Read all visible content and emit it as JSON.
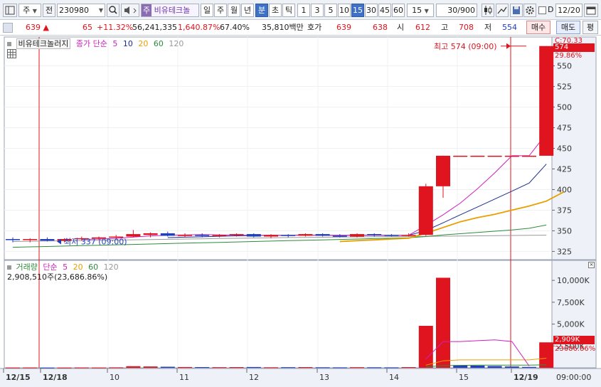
{
  "toolbar": {
    "period_type": "주",
    "prev_label": "전",
    "stock_code": "230980",
    "stock_badge": "주",
    "stock_name": "비유테크놀",
    "periods": [
      "일",
      "주",
      "월",
      "년",
      "분",
      "초",
      "틱"
    ],
    "selected_period": "분",
    "intervals": [
      "1",
      "3",
      "5",
      "10",
      "15",
      "30",
      "45",
      "60"
    ],
    "selected_interval": "15",
    "interval_value": "15",
    "count_value": "30",
    "count_total": "/900",
    "checkbox_label": "D",
    "date_value": "12/20"
  },
  "quote": {
    "price": "639",
    "up_arrow": "▲",
    "change": "65",
    "change_pct": "+11.32%",
    "volume": "56,241,335",
    "volume_pct": "1,640.87%",
    "ratio": "67.40%",
    "amount": "35,810백만",
    "hoga_label": "호가",
    "hoga_sell": "639",
    "hoga_buy": "638",
    "open_label": "시",
    "open": "612",
    "high_label": "고",
    "high": "708",
    "low_label": "저",
    "low": "554",
    "buy_button": "매수",
    "sell_button": "매도",
    "eval_button": "평"
  },
  "price_panel": {
    "title": "비유테크놀러지",
    "ma_label": "종가 단순",
    "ma_periods": [
      "5",
      "10",
      "20",
      "60",
      "120"
    ],
    "ma_colors": [
      "#d01fbf",
      "#1a2e8f",
      "#e8a000",
      "#2e8b3a",
      "#999999"
    ],
    "high_annotation": "최고 574 (09:00)",
    "low_annotation": "최저 337 (09:00)",
    "current_price_tag": "574",
    "top_right_value": "C:70.33",
    "top_right_pct": "29.86%"
  },
  "volume_panel": {
    "title": "거래량",
    "ma_label": "단순",
    "ma_periods": [
      "5",
      "20",
      "60",
      "120"
    ],
    "ma_colors": [
      "#d01fbf",
      "#e8a000",
      "#2e8b3a",
      "#999999"
    ],
    "volume_text": "2,908,510주(23,686.86%)",
    "current_volume_tag": "2,909K",
    "current_volume_pct": "23686.86%"
  },
  "time_axis": {
    "labels": [
      "12/15",
      "12/18",
      "10",
      "11",
      "12",
      "13",
      "14",
      "15",
      "12/19"
    ],
    "current_time": "09:00:00"
  },
  "chart_data": {
    "type": "candlestick",
    "price_axis": {
      "ticks": [
        325,
        350,
        375,
        400,
        425,
        450,
        475,
        500,
        525,
        550
      ],
      "ylim": [
        315,
        585
      ]
    },
    "volume_axis": {
      "ticks": [
        "2,500K",
        "5,000K",
        "7,500K",
        "10,000K"
      ],
      "tick_values": [
        2500,
        5000,
        7500,
        10000
      ],
      "ylim": [
        0,
        11800
      ]
    },
    "candles": [
      {
        "o": 340,
        "h": 342,
        "l": 336,
        "c": 339
      },
      {
        "o": 339,
        "h": 341,
        "l": 336,
        "c": 340
      },
      {
        "o": 340,
        "h": 342,
        "l": 337,
        "c": 338
      },
      {
        "o": 338,
        "h": 341,
        "l": 336,
        "c": 340
      },
      {
        "o": 340,
        "h": 343,
        "l": 338,
        "c": 341
      },
      {
        "o": 341,
        "h": 343,
        "l": 339,
        "c": 342
      },
      {
        "o": 342,
        "h": 345,
        "l": 340,
        "c": 343
      },
      {
        "o": 343,
        "h": 351,
        "l": 342,
        "c": 346
      },
      {
        "o": 345,
        "h": 348,
        "l": 342,
        "c": 347
      },
      {
        "o": 347,
        "h": 349,
        "l": 343,
        "c": 344
      },
      {
        "o": 344,
        "h": 347,
        "l": 342,
        "c": 345
      },
      {
        "o": 345,
        "h": 347,
        "l": 342,
        "c": 344
      },
      {
        "o": 344,
        "h": 346,
        "l": 342,
        "c": 345
      },
      {
        "o": 345,
        "h": 347,
        "l": 343,
        "c": 346
      },
      {
        "o": 346,
        "h": 347,
        "l": 342,
        "c": 343
      },
      {
        "o": 343,
        "h": 346,
        "l": 341,
        "c": 345
      },
      {
        "o": 345,
        "h": 346,
        "l": 342,
        "c": 344
      },
      {
        "o": 344,
        "h": 347,
        "l": 343,
        "c": 346
      },
      {
        "o": 346,
        "h": 347,
        "l": 343,
        "c": 344
      },
      {
        "o": 344,
        "h": 346,
        "l": 342,
        "c": 343
      },
      {
        "o": 343,
        "h": 347,
        "l": 342,
        "c": 346
      },
      {
        "o": 346,
        "h": 347,
        "l": 343,
        "c": 345
      },
      {
        "o": 345,
        "h": 346,
        "l": 343,
        "c": 344
      },
      {
        "o": 344,
        "h": 347,
        "l": 343,
        "c": 345
      },
      {
        "o": 345,
        "h": 407,
        "l": 344,
        "c": 404
      },
      {
        "o": 404,
        "h": 441,
        "l": 390,
        "c": 441
      },
      {
        "o": 441,
        "h": 441,
        "l": 441,
        "c": 441
      },
      {
        "o": 441,
        "h": 441,
        "l": 441,
        "c": 441
      },
      {
        "o": 441,
        "h": 441,
        "l": 441,
        "c": 441
      },
      {
        "o": 441,
        "h": 441,
        "l": 441,
        "c": 441
      },
      {
        "o": 441,
        "h": 441,
        "l": 441,
        "c": 441
      },
      {
        "o": 441,
        "h": 574,
        "l": 441,
        "c": 574
      }
    ],
    "volumes": [
      30,
      40,
      20,
      25,
      40,
      30,
      50,
      180,
      150,
      120,
      90,
      80,
      70,
      80,
      90,
      60,
      70,
      80,
      60,
      50,
      70,
      60,
      50,
      80,
      4800,
      10300,
      300,
      250,
      200,
      150,
      100,
      2909
    ],
    "volume_up": [
      1,
      1,
      0,
      1,
      1,
      1,
      1,
      1,
      1,
      0,
      1,
      0,
      1,
      1,
      0,
      1,
      0,
      1,
      0,
      0,
      1,
      0,
      0,
      1,
      1,
      1,
      0,
      0,
      0,
      0,
      0,
      1
    ],
    "ma5": [
      null,
      null,
      null,
      null,
      339.6,
      340,
      340.8,
      342.4,
      343.8,
      344.6,
      345,
      345.4,
      345,
      344.8,
      344.6,
      344.6,
      344.6,
      344.8,
      344.4,
      344.4,
      344.6,
      344.8,
      344.4,
      344.6,
      356.6,
      369.4,
      383.6,
      401,
      420.2,
      441,
      441,
      467.6
    ],
    "ma10": [
      null,
      null,
      null,
      null,
      null,
      null,
      null,
      null,
      null,
      341.7,
      342.3,
      342.7,
      343.4,
      343.9,
      344.2,
      344.5,
      344.6,
      344.9,
      344.6,
      344.5,
      344.6,
      344.5,
      344.6,
      344.5,
      350.4,
      359.7,
      369.4,
      378.9,
      388.5,
      398.1,
      407.9,
      430.9
    ],
    "ma20": [
      null,
      null,
      null,
      null,
      null,
      null,
      null,
      null,
      null,
      null,
      null,
      null,
      null,
      null,
      null,
      null,
      null,
      null,
      null,
      337,
      338,
      339,
      340,
      341,
      347,
      354,
      361,
      366,
      370,
      375,
      380,
      386,
      397
    ],
    "ma60": [
      330,
      330.5,
      331,
      331.5,
      332,
      332.5,
      333,
      333.5,
      334,
      334.5,
      335,
      335.5,
      336,
      336.5,
      337,
      337.5,
      338,
      338.5,
      339,
      339.5,
      340,
      340.5,
      341,
      341.5,
      343,
      345,
      346.5,
      348,
      349.5,
      351,
      353,
      357
    ],
    "ma120": [
      337,
      337.3,
      337.6,
      337.9,
      338.2,
      338.5,
      338.8,
      339.1,
      339.4,
      339.7,
      340,
      340.3,
      340.6,
      340.9,
      341.2,
      341.5,
      341.8,
      342,
      342.2,
      342.4,
      342.6,
      342.8,
      343,
      343.1,
      343.3,
      343.5,
      343.7,
      343.9,
      344.1,
      344.3,
      344.5,
      344.8
    ],
    "vol_ma5": [
      null,
      null,
      null,
      null,
      null,
      null,
      null,
      null,
      null,
      null,
      null,
      null,
      null,
      null,
      null,
      null,
      null,
      null,
      null,
      null,
      null,
      null,
      null,
      null,
      1000,
      3000,
      3000,
      3100,
      3200,
      3000,
      200,
      null
    ],
    "vol_ma20": [
      null,
      null,
      null,
      null,
      null,
      null,
      null,
      null,
      null,
      null,
      null,
      null,
      null,
      null,
      null,
      null,
      null,
      null,
      null,
      null,
      null,
      null,
      null,
      null,
      300,
      800,
      900,
      900,
      900,
      900,
      900,
      1100
    ],
    "vol_ma60": [
      null,
      null,
      null,
      null,
      null,
      null,
      null,
      null,
      null,
      null,
      null,
      null,
      null,
      null,
      null,
      null,
      null,
      null,
      null,
      null,
      null,
      null,
      null,
      null,
      100,
      250,
      280,
      300,
      300,
      300,
      300,
      350
    ]
  }
}
